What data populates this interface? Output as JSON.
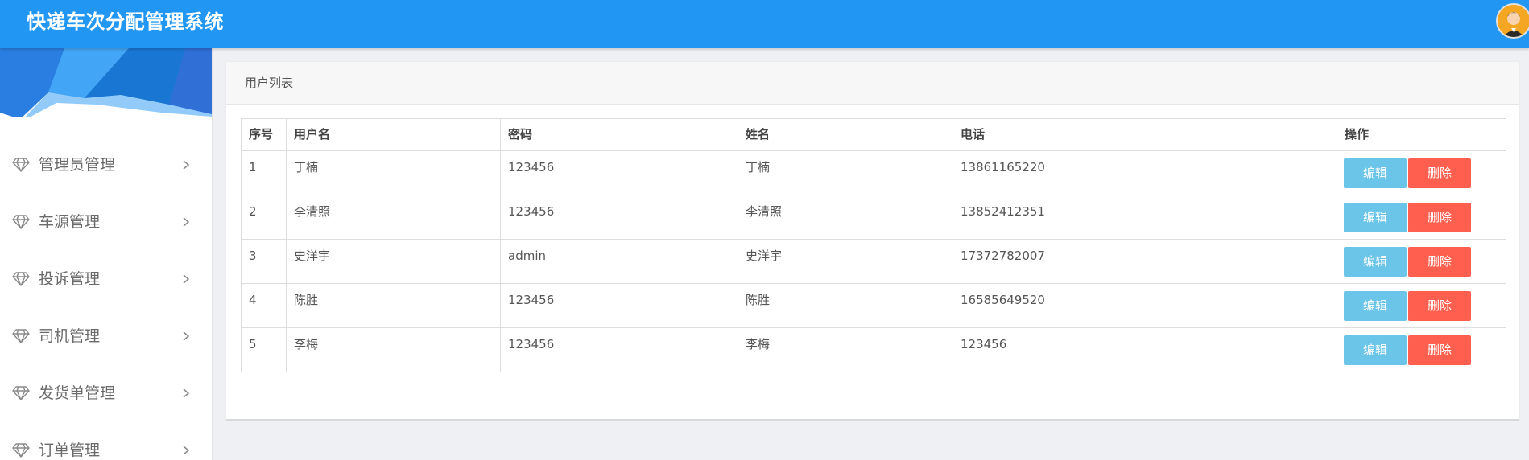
{
  "header": {
    "app_title": "快递车次分配管理系统",
    "avatar_icon": "user-avatar-icon",
    "brand_color": "#2196f3"
  },
  "sidebar": {
    "item_icon": "diamond-icon",
    "items": [
      {
        "label": "管理员管理"
      },
      {
        "label": "车源管理"
      },
      {
        "label": "投诉管理"
      },
      {
        "label": "司机管理"
      },
      {
        "label": "发货单管理"
      },
      {
        "label": "订单管理"
      }
    ]
  },
  "main": {
    "panel_title": "用户列表",
    "table": {
      "columns": [
        "序号",
        "用户名",
        "密码",
        "姓名",
        "电话",
        "操作"
      ],
      "rows": [
        {
          "index": "1",
          "username": "丁楠",
          "password": "123456",
          "name": "丁楠",
          "phone": "13861165220"
        },
        {
          "index": "2",
          "username": "李清照",
          "password": "123456",
          "name": "李清照",
          "phone": "13852412351"
        },
        {
          "index": "3",
          "username": "史洋宇",
          "password": "admin",
          "name": "史洋宇",
          "phone": "17372782007"
        },
        {
          "index": "4",
          "username": "陈胜",
          "password": "123456",
          "name": "陈胜",
          "phone": "16585649520"
        },
        {
          "index": "5",
          "username": "李梅",
          "password": "123456",
          "name": "李梅",
          "phone": "123456"
        }
      ],
      "edit_label": "编辑",
      "delete_label": "删除",
      "edit_color": "#6bc5e8",
      "delete_color": "#ff5f4e"
    }
  }
}
